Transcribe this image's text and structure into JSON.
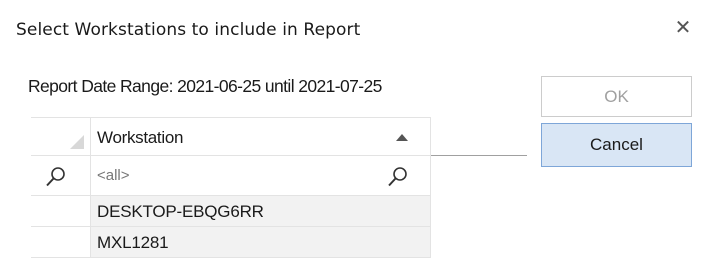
{
  "dialog": {
    "title": "Select Workstations to include in Report",
    "close_glyph": "✕"
  },
  "report": {
    "date_range_text": "Report Date Range: 2021-06-25 until 2021-07-25"
  },
  "buttons": {
    "ok_label": "OK",
    "cancel_label": "Cancel"
  },
  "grid": {
    "column_header": "Workstation",
    "sort_direction": "ascending",
    "filter_text": "<all>",
    "rows": [
      {
        "workstation": "DESKTOP-EBQG6RR"
      },
      {
        "workstation": "MXL1281"
      }
    ]
  }
}
